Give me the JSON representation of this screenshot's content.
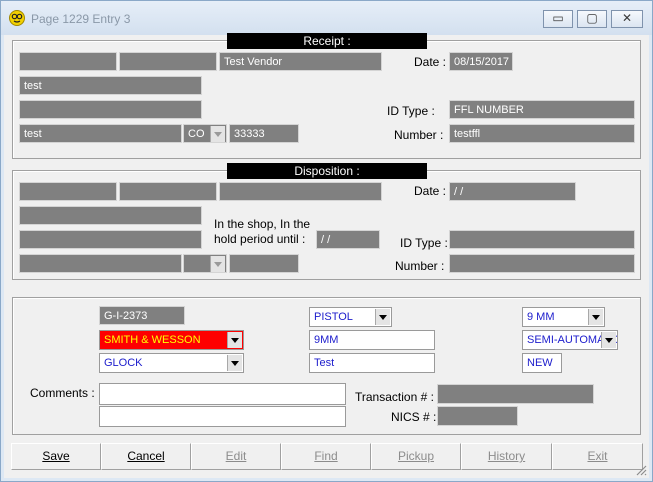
{
  "window": {
    "title": "Page 1229  Entry 3",
    "controls": {
      "minimize": "▭",
      "maximize": "▢",
      "close": "✕"
    }
  },
  "receipt": {
    "heading": "Receipt :",
    "vendor": "Test Vendor",
    "address1": "test",
    "city": "test",
    "state": "CO",
    "zip": "33333",
    "date_label": "Date :",
    "date": "08/15/2017",
    "id_type_label": "ID Type :",
    "id_type": "FFL NUMBER",
    "number_label": "Number :",
    "number": "testffl"
  },
  "disposition": {
    "heading": "Disposition :",
    "date_label": "Date :",
    "date": " /  /",
    "hold_label_line1": "In the shop, In the",
    "hold_label_line2": "hold period until :",
    "hold_date": " /  /",
    "id_type_label": "ID Type :",
    "number_label": "Number :"
  },
  "firearm": {
    "serial": "G-I-2373",
    "manufacturer": "SMITH & WESSON",
    "importer": "GLOCK",
    "type": "PISTOL",
    "caliber_text": "9MM",
    "model": "Test",
    "caliber": "9 MM",
    "action": "SEMI-AUTOMATIC",
    "condition": "NEW",
    "comments_label": "Comments :",
    "transaction_label": "Transaction # :",
    "nics_label": "NICS # :"
  },
  "buttons": {
    "save": "Save",
    "cancel": "Cancel",
    "edit": "Edit",
    "find": "Find",
    "pickup": "Pickup",
    "history": "History",
    "exit": "Exit"
  },
  "colors": {
    "field_gray": "#808080",
    "manufacturer_bg": "#ff0000",
    "manufacturer_text": "#ffff00",
    "value_blue": "#1c1ccc"
  }
}
